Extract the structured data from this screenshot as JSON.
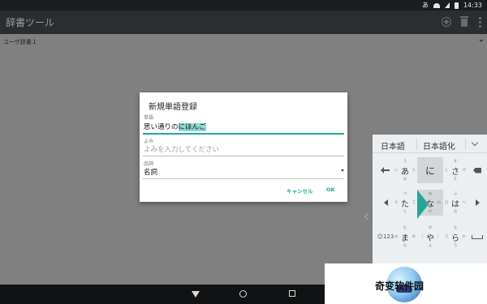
{
  "status_bar": {
    "ime_indicator": "あ",
    "time": "14:33"
  },
  "app_bar": {
    "title": "辞書ツール",
    "actions": [
      "add-circle-icon",
      "trash-icon",
      "more-vert-icon"
    ]
  },
  "dictionary": {
    "selected": "ユーザ辞書１"
  },
  "dialog": {
    "title": "新規単語登録",
    "word": {
      "label": "単語",
      "value_prefix": "思い通りの",
      "value_composing": "にほんご"
    },
    "reading": {
      "label": "よみ",
      "placeholder": "よみを入力してください"
    },
    "pos": {
      "label": "品詞",
      "value": "名詞"
    },
    "cancel_label": "キャンセル",
    "ok_label": "OK"
  },
  "keyboard": {
    "candidates": [
      "日本語",
      "日本語化"
    ],
    "rows": [
      [
        {
          "icon": "arrow-left-icon"
        },
        {
          "main": "あ",
          "t": "う",
          "l": "い",
          "r": "え",
          "b": "お"
        },
        {
          "main": "に",
          "active": true
        },
        {
          "main": "さ",
          "t": "す",
          "l": "し",
          "r": "せ",
          "b": "そ"
        },
        {
          "icon": "backspace-icon"
        }
      ],
      [
        {
          "icon": "cursor-left-icon"
        },
        {
          "main": "た",
          "t": "つ",
          "l": "ち",
          "r": "て",
          "b": "と"
        },
        {
          "main": "な",
          "t": "ぬ",
          "l": "に",
          "r": "ね",
          "b": "の",
          "active": true
        },
        {
          "main": "は",
          "t": "ふ",
          "l": "ひ",
          "r": "へ",
          "b": "ほ"
        },
        {
          "icon": "cursor-right-icon"
        }
      ],
      [
        {
          "label": "☺123"
        },
        {
          "main": "ま",
          "t": "む",
          "l": "み",
          "r": "め",
          "b": "も"
        },
        {
          "main": "や",
          "l": "（",
          "r": "）",
          "t": "ゆ",
          "b": "よ"
        },
        {
          "main": "ら",
          "t": "る",
          "l": "り",
          "r": "れ",
          "b": "ろ"
        },
        {
          "icon": "space-icon"
        }
      ]
    ]
  },
  "watermark": {
    "text": "奇变软件园"
  }
}
